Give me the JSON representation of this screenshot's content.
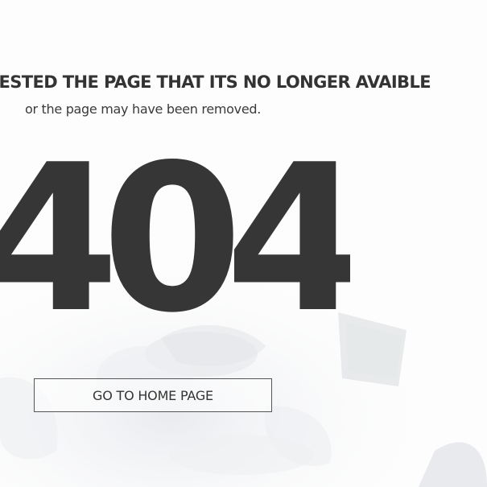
{
  "error": {
    "headline": "ESTED THE PAGE THAT ITS NO LONGER AVAIBLE",
    "subline": "or the page may have been removed.",
    "code": "404"
  },
  "actions": {
    "home_button_label": "GO TO HOME PAGE"
  },
  "colors": {
    "text": "#333333",
    "background": "#ffffff",
    "button_border": "#555555"
  }
}
